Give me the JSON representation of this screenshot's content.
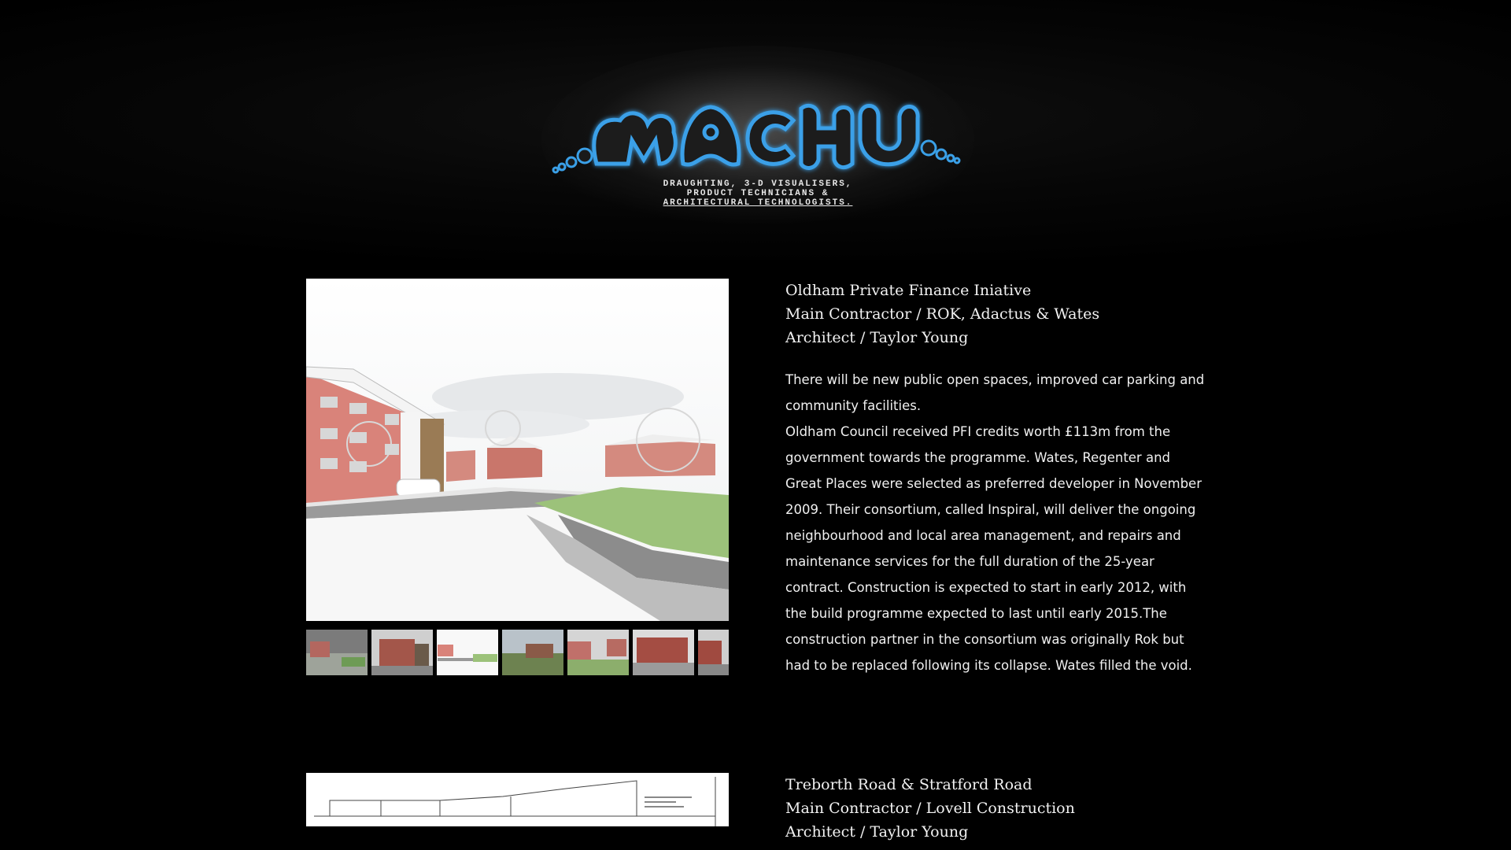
{
  "logo": {
    "wordmark": "MACH",
    "tagline": [
      "DRAUGHTING, 3-D VISUALISERS,",
      "PRODUCT TECHNICIANS &",
      "ARCHITECTURAL TECHNOLOGISTS."
    ],
    "accent_color": "#3aa0e8"
  },
  "projects": [
    {
      "title_lines": [
        "Oldham Private Finance Iniative",
        "Main Contractor / ROK, Adactus & Wates",
        "Architect / Taylor Young"
      ],
      "description": [
        "There will be new public open spaces, improved car parking and community facilities.",
        "Oldham Council received PFI credits worth £113m from the government towards the programme. Wates, Regenter and Great Places were selected as preferred developer in November 2009. Their consortium, called Inspiral, will deliver the ongoing neighbourhood and local area management, and repairs and maintenance services for the full duration of the 25-year contract. Construction is expected to start in early 2012, with the build programme expected to last until early 2015.The construction partner in the consortium was originally Rok but had to be replaced following its collapse. Wates filled the void."
      ],
      "thumbnail_count": 7,
      "active_thumbnail": 3
    },
    {
      "title_lines": [
        "Treborth Road & Stratford Road",
        "Main Contractor / Lovell Construction",
        "Architect / Taylor Young"
      ]
    }
  ]
}
